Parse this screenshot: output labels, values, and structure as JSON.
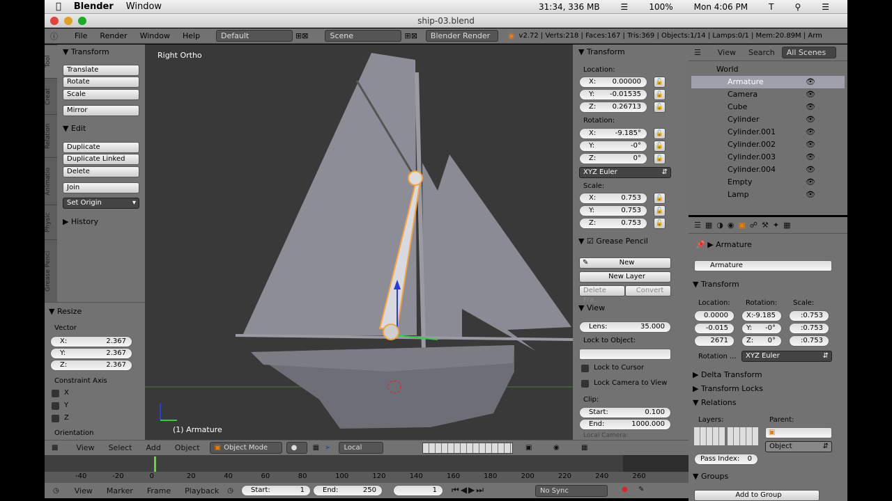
{
  "mac_menubar": {
    "app": "Blender",
    "menu": "Window",
    "stats": "31:34, 336 MB",
    "battery": "100%",
    "clock": "Mon 4:06 PM",
    "user": "T"
  },
  "window": {
    "title": "ship-03.blend"
  },
  "info": {
    "menus": [
      "File",
      "Render",
      "Window",
      "Help"
    ],
    "layout": "Default",
    "scene": "Scene",
    "engine": "Blender Render",
    "stats": "v2.72 | Verts:218 | Faces:167 | Tris:369 | Objects:1/14 | Lamps:0/1 | Mem:20.89M | Arm"
  },
  "tool_tabs": [
    "Tool",
    "Creat",
    "Relation",
    "Animatio",
    "Physic",
    "Grease Penci"
  ],
  "toolshelf": {
    "transform_header": "Transform",
    "transform_buttons": [
      "Translate",
      "Rotate",
      "Scale"
    ],
    "mirror": "Mirror",
    "edit_header": "Edit",
    "edit_buttons": [
      "Duplicate",
      "Duplicate Linked",
      "Delete"
    ],
    "join": "Join",
    "set_origin": "Set Origin",
    "history": "History"
  },
  "operator": {
    "header": "Resize",
    "vector_label": "Vector",
    "vector": [
      {
        "l": "X:",
        "v": "2.367"
      },
      {
        "l": "Y:",
        "v": "2.367"
      },
      {
        "l": "Z:",
        "v": "2.367"
      }
    ],
    "constraint_label": "Constraint Axis",
    "axes": [
      "X",
      "Y",
      "Z"
    ],
    "orientation": "Orientation"
  },
  "viewport": {
    "view_name": "Right Ortho",
    "object_label": "(1) Armature"
  },
  "npanel": {
    "transform": "Transform",
    "location_label": "Location:",
    "location": [
      {
        "l": "X:",
        "v": "0.00000"
      },
      {
        "l": "Y:",
        "v": "-0.01535"
      },
      {
        "l": "Z:",
        "v": "0.26713"
      }
    ],
    "rotation_label": "Rotation:",
    "rotation": [
      {
        "l": "X:",
        "v": "-9.185°"
      },
      {
        "l": "Y:",
        "v": "-0°"
      },
      {
        "l": "Z:",
        "v": "0°"
      }
    ],
    "rotation_mode": "XYZ Euler",
    "scale_label": "Scale:",
    "scale": [
      {
        "l": "X:",
        "v": "0.753"
      },
      {
        "l": "Y:",
        "v": "0.753"
      },
      {
        "l": "Z:",
        "v": "0.753"
      }
    ],
    "grease_pencil": "Grease Pencil",
    "gp_new": "New",
    "gp_new_layer": "New Layer",
    "gp_delete": "Delete Fra...",
    "gp_convert": "Convert",
    "view": "View",
    "lens_label": "Lens:",
    "lens": "35.000",
    "lock_object": "Lock to Object:",
    "lock_cursor": "Lock to Cursor",
    "lock_camera": "Lock Camera to View",
    "clip": "Clip:",
    "clip_start_label": "Start:",
    "clip_start": "0.100",
    "clip_end_label": "End:",
    "clip_end": "1000.000",
    "local_camera": "Local Camera:"
  },
  "outliner": {
    "view": "View",
    "search": "Search",
    "scenes": "All Scenes",
    "items": [
      "World",
      "Armature",
      "Camera",
      "Cube",
      "Cylinder",
      "Cylinder.001",
      "Cylinder.002",
      "Cylinder.003",
      "Cylinder.004",
      "Empty",
      "Lamp"
    ]
  },
  "properties": {
    "breadcrumb": "Armature",
    "name": "Armature",
    "transform": "Transform",
    "location_label": "Location:",
    "rotation_label": "Rotation:",
    "scale_label": "Scale:",
    "location": [
      "0.0000",
      "-0.015",
      "2671"
    ],
    "rotation": [
      {
        "l": "X:",
        "v": "-9.185"
      },
      {
        "l": "Y:",
        "v": "-0°"
      },
      {
        "l": "Z:",
        "v": "0°"
      }
    ],
    "scale": [
      ":0.753",
      ":0.753",
      ":0.753"
    ],
    "rotation_mode_label": "Rotation ...",
    "rotation_mode": "XYZ Euler",
    "delta": "Delta Transform",
    "locks": "Transform Locks",
    "relations": "Relations",
    "layers": "Layers:",
    "parent": "Parent:",
    "parent_type": "Object",
    "pass_index_label": "Pass Index:",
    "pass_index": "0",
    "groups": "Groups",
    "add_group": "Add to Group"
  },
  "view_header": {
    "menus": [
      "View",
      "Select",
      "Add",
      "Object"
    ],
    "mode": "Object Mode",
    "orientation": "Local"
  },
  "timeline": {
    "ticks": [
      "-40",
      "-20",
      "0",
      "20",
      "40",
      "60",
      "80",
      "100",
      "120",
      "140",
      "160",
      "180",
      "200",
      "220",
      "240",
      "260"
    ],
    "current": "1"
  },
  "tl_header": {
    "menus": [
      "View",
      "Marker",
      "Frame",
      "Playback"
    ],
    "start_label": "Start:",
    "start": "1",
    "end_label": "End:",
    "end": "250",
    "frame": "1",
    "sync": "No Sync"
  }
}
